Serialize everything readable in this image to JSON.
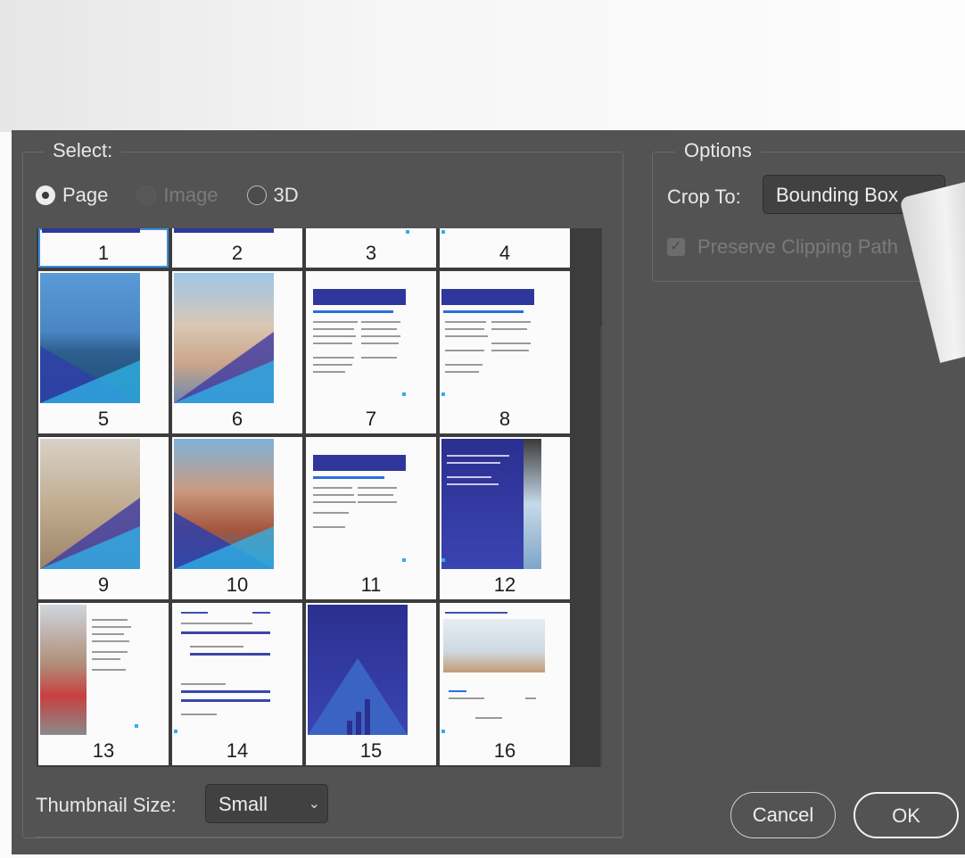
{
  "select_group": {
    "legend": "Select:",
    "radios": [
      {
        "label": "Page",
        "state": "checked"
      },
      {
        "label": "Image",
        "state": "disabled"
      },
      {
        "label": "3D",
        "state": "unchecked"
      }
    ]
  },
  "thumbnails": [
    "1",
    "2",
    "3",
    "4",
    "5",
    "6",
    "7",
    "8",
    "9",
    "10",
    "11",
    "12",
    "13",
    "14",
    "15",
    "16"
  ],
  "selected_thumbnail": "1",
  "options_group": {
    "legend": "Options",
    "crop_to_label": "Crop To:",
    "crop_to_value": "Bounding Box",
    "preserve_label": "Preserve Clipping Path",
    "preserve_checked": true,
    "preserve_disabled": true
  },
  "footer": {
    "thumbnail_size_label": "Thumbnail Size:",
    "thumbnail_size_value": "Small",
    "cancel_label": "Cancel",
    "ok_label": "OK"
  },
  "colors": {
    "dialog_bg": "#535353",
    "selection_outline": "#3a8fde",
    "brand_navy": "#30379a",
    "brand_cyan": "#2fb6e8"
  }
}
